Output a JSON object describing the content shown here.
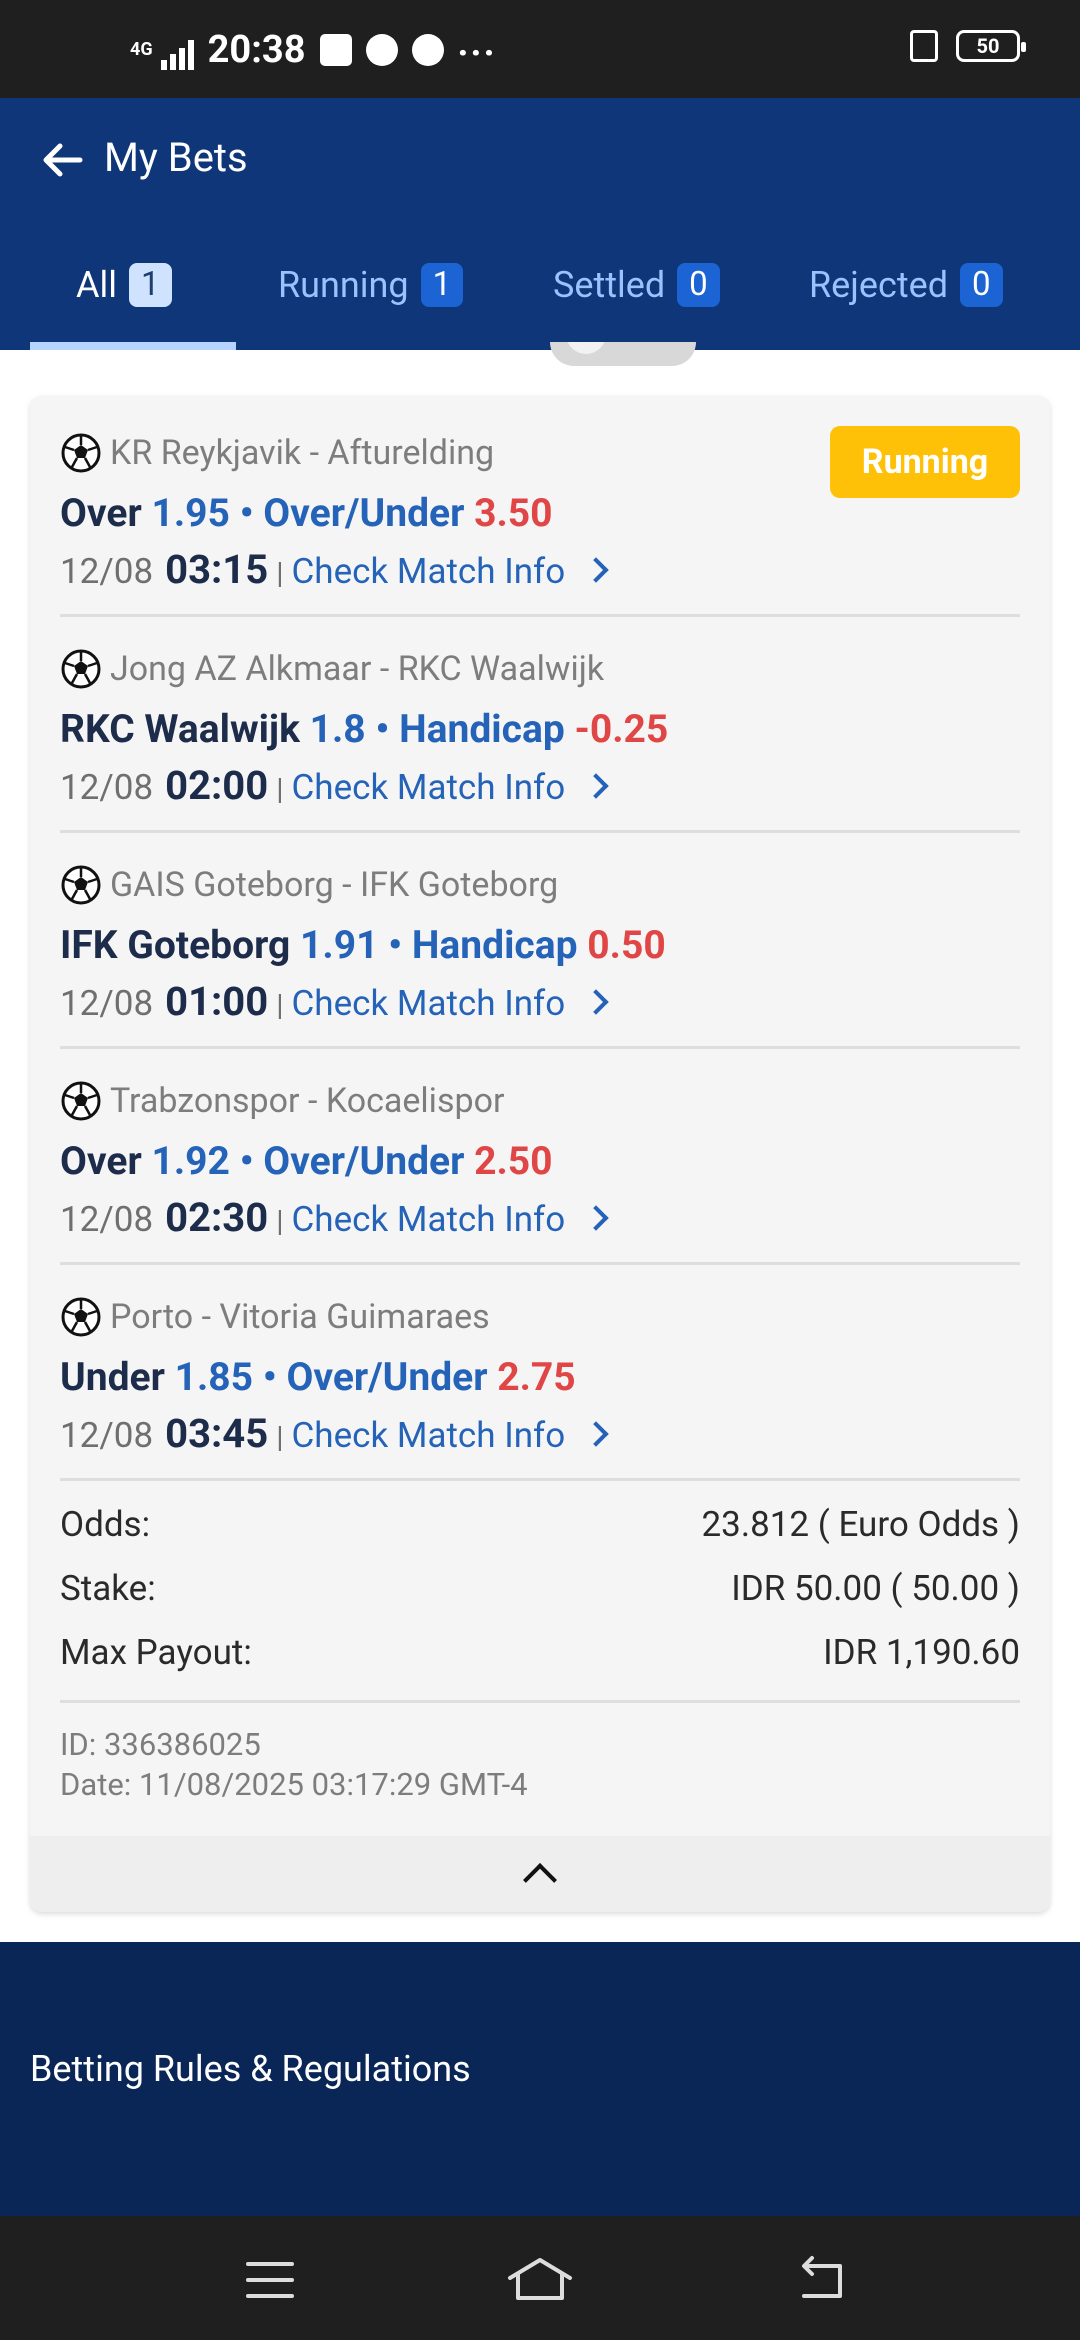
{
  "status_bar": {
    "network": "4G",
    "time": "20:38",
    "battery": "50",
    "more": "..."
  },
  "header": {
    "title": "My Bets"
  },
  "tabs": [
    {
      "label": "All",
      "count": "1"
    },
    {
      "label": "Running",
      "count": "1"
    },
    {
      "label": "Settled",
      "count": "0"
    },
    {
      "label": "Rejected",
      "count": "0"
    }
  ],
  "bet": {
    "status": "Running",
    "legs": [
      {
        "match": "KR Reykjavik - Afturelding",
        "selection": "Over",
        "odds": "1.95",
        "market": "Over/Under",
        "line": "3.50",
        "date": "12/08",
        "time": "03:15",
        "link": "Check Match Info"
      },
      {
        "match": "Jong AZ Alkmaar - RKC Waalwijk",
        "selection": "RKC Waalwijk",
        "odds": "1.8",
        "market": "Handicap",
        "line": "-0.25",
        "date": "12/08",
        "time": "02:00",
        "link": "Check Match Info"
      },
      {
        "match": "GAIS Goteborg - IFK Goteborg",
        "selection": "IFK Goteborg",
        "odds": "1.91",
        "market": "Handicap",
        "line": "0.50",
        "date": "12/08",
        "time": "01:00",
        "link": "Check Match Info"
      },
      {
        "match": "Trabzonspor - Kocaelispor",
        "selection": "Over",
        "odds": "1.92",
        "market": "Over/Under",
        "line": "2.50",
        "date": "12/08",
        "time": "02:30",
        "link": "Check Match Info"
      },
      {
        "match": "Porto - Vitoria Guimaraes",
        "selection": "Under",
        "odds": "1.85",
        "market": "Over/Under",
        "line": "2.75",
        "date": "12/08",
        "time": "03:45",
        "link": "Check Match Info"
      }
    ],
    "summary": {
      "odds_label": "Odds:",
      "odds_value": "23.812 ( Euro Odds )",
      "stake_label": "Stake:",
      "stake_value": "IDR 50.00 ( 50.00 )",
      "payout_label": "Max Payout:",
      "payout_value": "IDR 1,190.60"
    },
    "id_text": "ID: 336386025",
    "date_text": "Date: 11/08/2025 03:17:29 GMT-4"
  },
  "footer": {
    "link": "Betting Rules & Regulations"
  }
}
